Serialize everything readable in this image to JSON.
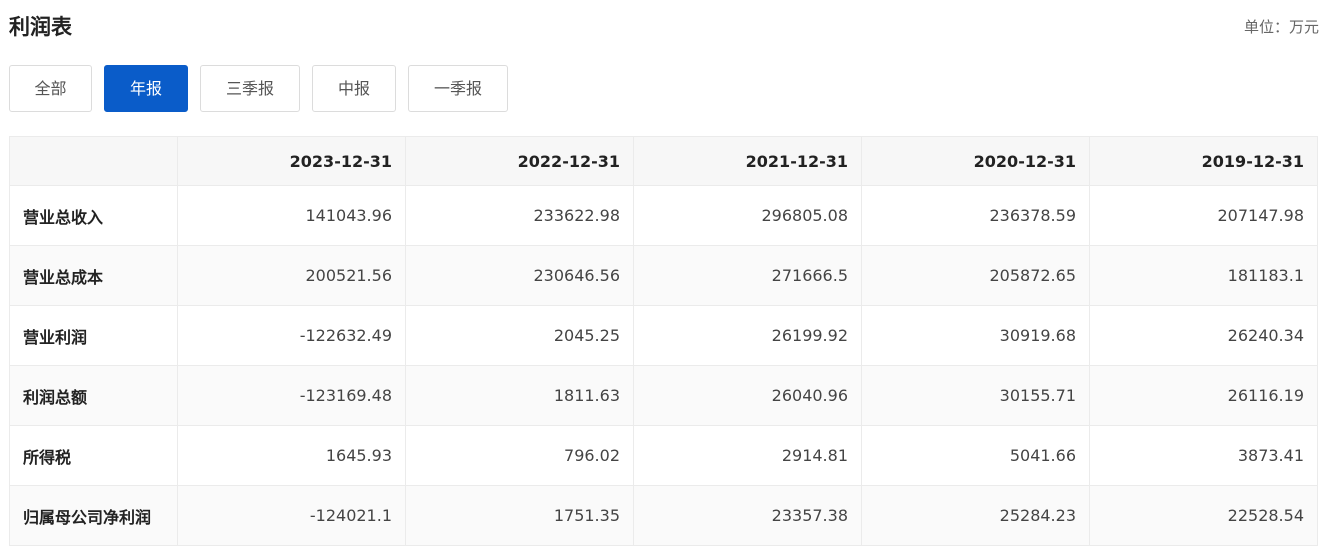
{
  "header": {
    "title": "利润表",
    "unit": "单位：万元"
  },
  "tabs": [
    {
      "label": "全部",
      "active": false
    },
    {
      "label": "年报",
      "active": true
    },
    {
      "label": "三季报",
      "active": false
    },
    {
      "label": "中报",
      "active": false
    },
    {
      "label": "一季报",
      "active": false
    }
  ],
  "colors": {
    "accent": "#0a5cc9"
  },
  "table": {
    "columns": [
      "",
      "2023-12-31",
      "2022-12-31",
      "2021-12-31",
      "2020-12-31",
      "2019-12-31"
    ],
    "rows": [
      {
        "label": "营业总收入",
        "values": [
          "141043.96",
          "233622.98",
          "296805.08",
          "236378.59",
          "207147.98"
        ]
      },
      {
        "label": "营业总成本",
        "values": [
          "200521.56",
          "230646.56",
          "271666.5",
          "205872.65",
          "181183.1"
        ]
      },
      {
        "label": "营业利润",
        "values": [
          "-122632.49",
          "2045.25",
          "26199.92",
          "30919.68",
          "26240.34"
        ]
      },
      {
        "label": "利润总额",
        "values": [
          "-123169.48",
          "1811.63",
          "26040.96",
          "30155.71",
          "26116.19"
        ]
      },
      {
        "label": "所得税",
        "values": [
          "1645.93",
          "796.02",
          "2914.81",
          "5041.66",
          "3873.41"
        ]
      },
      {
        "label": "归属母公司净利润",
        "values": [
          "-124021.1",
          "1751.35",
          "23357.38",
          "25284.23",
          "22528.54"
        ]
      }
    ]
  }
}
